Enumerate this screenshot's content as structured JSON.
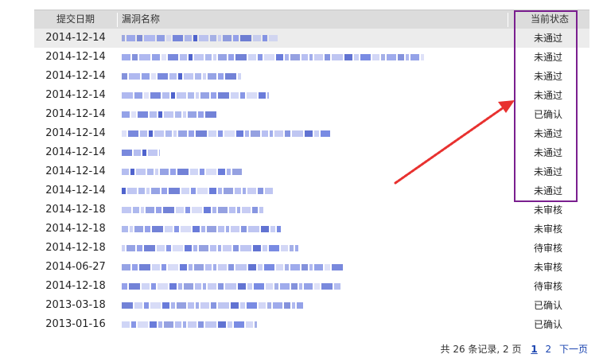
{
  "columns": {
    "date": "提交日期",
    "name": "漏洞名称",
    "status": "当前状态"
  },
  "rows": [
    {
      "date": "2014-12-14",
      "status": "未通过"
    },
    {
      "date": "2014-12-14",
      "status": "未通过"
    },
    {
      "date": "2014-12-14",
      "status": "未通过"
    },
    {
      "date": "2014-12-14",
      "status": "未通过"
    },
    {
      "date": "2014-12-14",
      "status": "已确认"
    },
    {
      "date": "2014-12-14",
      "status": "未通过"
    },
    {
      "date": "2014-12-14",
      "status": "未通过"
    },
    {
      "date": "2014-12-14",
      "status": "未通过"
    },
    {
      "date": "2014-12-14",
      "status": "未通过"
    },
    {
      "date": "2014-12-18",
      "status": "未审核"
    },
    {
      "date": "2014-12-18",
      "status": "未审核"
    },
    {
      "date": "2014-12-18",
      "status": "待审核"
    },
    {
      "date": "2014-06-27",
      "status": "未审核"
    },
    {
      "date": "2014-12-18",
      "status": "待审核"
    },
    {
      "date": "2013-03-18",
      "status": "已确认"
    },
    {
      "date": "2013-01-16",
      "status": "已确认"
    }
  ],
  "pager": {
    "summary": "共 26 条记录, 2 页",
    "page1": "1",
    "page2": "2",
    "next": "下一页"
  },
  "colors": {
    "annotation": "#7a1f8f",
    "arrow": "#e8312f",
    "link": "#1a44b0"
  }
}
